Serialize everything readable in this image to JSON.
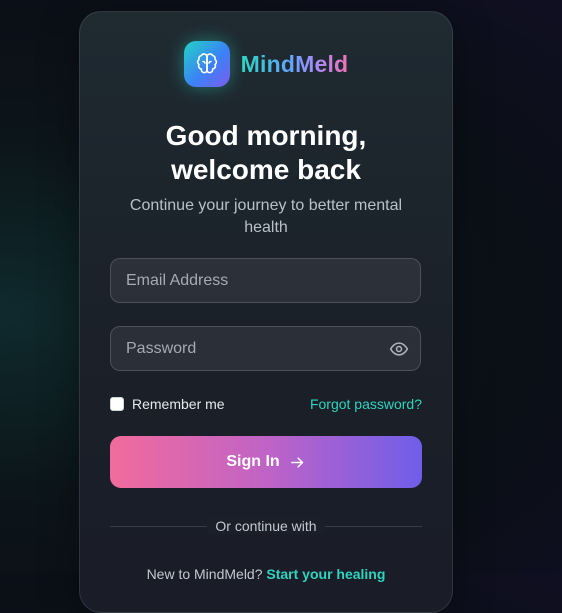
{
  "brand": {
    "name": "MindMeld",
    "logo_icon": "brain-icon"
  },
  "heading": {
    "line1": "Good morning,",
    "line2": "welcome back"
  },
  "subtitle": "Continue your journey to better mental health",
  "form": {
    "email_placeholder": "Email Address",
    "email_value": "",
    "password_placeholder": "Password",
    "password_value": "",
    "password_toggle_icon": "eye-icon",
    "remember_label": "Remember me",
    "remember_checked": false,
    "forgot_label": "Forgot password?",
    "submit_label": "Sign In",
    "submit_icon": "arrow-right-icon"
  },
  "divider_text": "Or continue with",
  "footer": {
    "prompt": "New to MindMeld?",
    "link_label": "Start your healing"
  },
  "colors": {
    "accent_teal": "#2dd4bf",
    "button_start": "#f26b9c",
    "button_end": "#6f5ee9"
  }
}
